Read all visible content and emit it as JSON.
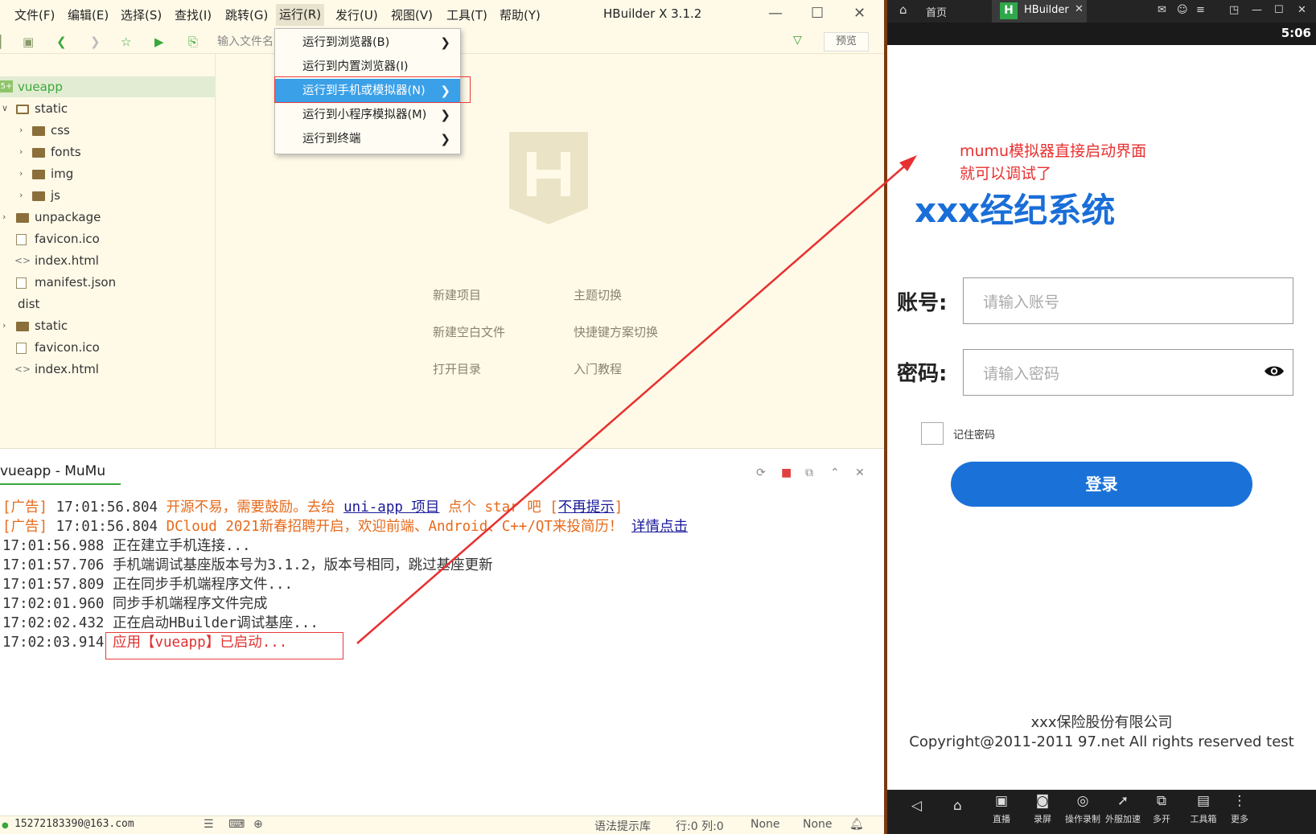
{
  "ide": {
    "menus": [
      "文件(F)",
      "编辑(E)",
      "选择(S)",
      "查找(I)",
      "跳转(G)",
      "运行(R)",
      "发行(U)",
      "视图(V)",
      "工具(T)",
      "帮助(Y)"
    ],
    "title": "HBuilder X 3.1.2",
    "filter_placeholder": "输入文件名",
    "preview_label": "预览",
    "tree": [
      {
        "label": "vueapp",
        "level": 0,
        "type": "project",
        "selected": true
      },
      {
        "label": "static",
        "level": 0,
        "type": "folder-open"
      },
      {
        "label": "css",
        "level": 1,
        "type": "folder"
      },
      {
        "label": "fonts",
        "level": 1,
        "type": "folder"
      },
      {
        "label": "img",
        "level": 1,
        "type": "folder"
      },
      {
        "label": "js",
        "level": 1,
        "type": "folder"
      },
      {
        "label": "unpackage",
        "level": 0,
        "type": "folder"
      },
      {
        "label": "favicon.ico",
        "level": 0,
        "type": "image"
      },
      {
        "label": "index.html",
        "level": 0,
        "type": "code"
      },
      {
        "label": "manifest.json",
        "level": 0,
        "type": "json"
      },
      {
        "label": "dist",
        "level": 0,
        "type": "plain"
      },
      {
        "label": "static",
        "level": 0,
        "type": "folder"
      },
      {
        "label": "favicon.ico",
        "level": 0,
        "type": "image"
      },
      {
        "label": "index.html",
        "level": 0,
        "type": "code"
      }
    ],
    "welcome_links": {
      "new_project": "新建项目",
      "theme_switch": "主题切换",
      "new_blank_file": "新建空白文件",
      "shortcut_switch": "快捷键方案切换",
      "open_directory": "打开目录",
      "tutorial": "入门教程"
    },
    "run_menu": [
      {
        "label": "运行到浏览器(B)",
        "highlighted": false
      },
      {
        "label": "运行到内置浏览器(I)",
        "highlighted": false
      },
      {
        "label": "运行到手机或模拟器(N)",
        "highlighted": true
      },
      {
        "label": "运行到小程序模拟器(M)",
        "highlighted": false
      },
      {
        "label": "运行到终端",
        "highlighted": false
      }
    ],
    "console": {
      "tab_title": "vueapp - MuMu",
      "lines": [
        {
          "time": "17:01:56.804",
          "prefix": "[广告] ",
          "text1": "开源不易，需要鼓励。去给 ",
          "link1": "uni-app 项目",
          "text2": " 点个 star 吧 [",
          "link2": "不再提示",
          "text3": "]"
        },
        {
          "time": "17:01:56.804",
          "prefix": "[广告] ",
          "text1": "DCloud 2021新春招聘开启，欢迎前端、Android、C++/QT来投简历！ ",
          "link1": "详情点击"
        },
        {
          "time": "17:01:56.988",
          "text": "正在建立手机连接..."
        },
        {
          "time": "17:01:57.706",
          "text": "手机端调试基座版本号为3.1.2，版本号相同，跳过基座更新"
        },
        {
          "time": "17:01:57.809",
          "text": "正在同步手机端程序文件..."
        },
        {
          "time": "17:02:01.960",
          "text": "同步手机端程序文件完成"
        },
        {
          "time": "17:02:02.432",
          "text": "正在启动HBuilder调试基座..."
        },
        {
          "time": "17:02:03.914",
          "text": "应用【vueapp】已启动..."
        }
      ]
    },
    "status": {
      "user": "15272183390@163.com",
      "syntax_lib": "语法提示库",
      "position": "行:0  列:0",
      "encoding": "None",
      "language": "None"
    }
  },
  "emulator": {
    "home_tab": "首页",
    "app_tab": "HBuilder",
    "time": "5:06",
    "annotation": [
      "mumu模拟器直接启动界面",
      "就可以调试了"
    ],
    "app_title": "xxx经纪系统",
    "account_label": "账号:",
    "account_placeholder": "请输入账号",
    "password_label": "密码:",
    "password_placeholder": "请输入密码",
    "remember_label": "记住密码",
    "login_button": "登录",
    "company": "xxx保险股份有限公司",
    "copyright": "Copyright@2011-2011 97.net All rights reserved test",
    "nav_items": [
      "直播",
      "录屏",
      "操作录制",
      "外服加速",
      "多开",
      "工具箱",
      "更多"
    ]
  },
  "colors": {
    "ide_bg": "#fffae8",
    "menu_highlight": "#3aa0e8",
    "annotation_red": "#e83030",
    "app_blue": "#1a6ed8",
    "hbuilder_green": "#3aa83a"
  }
}
